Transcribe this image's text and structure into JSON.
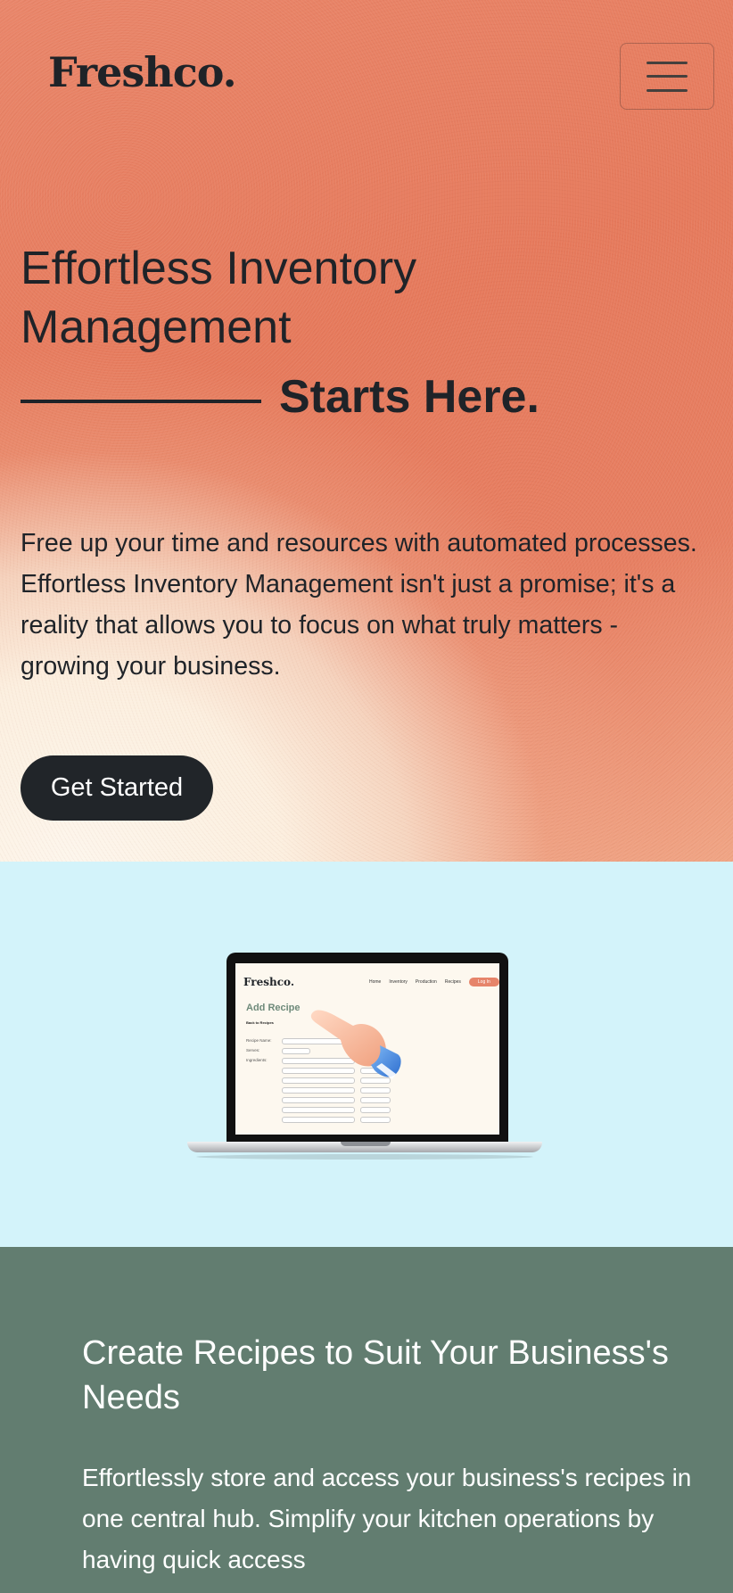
{
  "brand": {
    "logo_text": "Freshco."
  },
  "nav": {
    "menu_icon": "hamburger-menu-icon"
  },
  "hero": {
    "title": "Effortless Inventory Management",
    "tagline": "Starts Here.",
    "description": "Free up your time and resources with automated processes. Effortless Inventory Management isn't just a promise; it's a reality that allows you to focus on what truly matters - growing your business.",
    "cta_label": "Get Started"
  },
  "showcase": {
    "laptop_screen": {
      "logo": "Freshco.",
      "nav_items": [
        "Home",
        "Inventory",
        "Production",
        "Recipes"
      ],
      "login_label": "Log In",
      "heading": "Add Recipe",
      "subheading": "Back to Recipes",
      "labels": [
        "Recipe Name:",
        "Serves:",
        "Ingredients:"
      ]
    }
  },
  "feature": {
    "title": "Create Recipes to Suit Your Business's Needs",
    "description": "Effortlessly store and access your business's recipes in one central hub. Simplify your kitchen operations by having quick access"
  },
  "colors": {
    "hero_coral": "#e67a5c",
    "hero_cream": "#fdf6ec",
    "dark": "#212529",
    "showcase_bg": "#d3f3fa",
    "feature_bg": "#627d70",
    "accent_green": "#6e8a7a"
  }
}
